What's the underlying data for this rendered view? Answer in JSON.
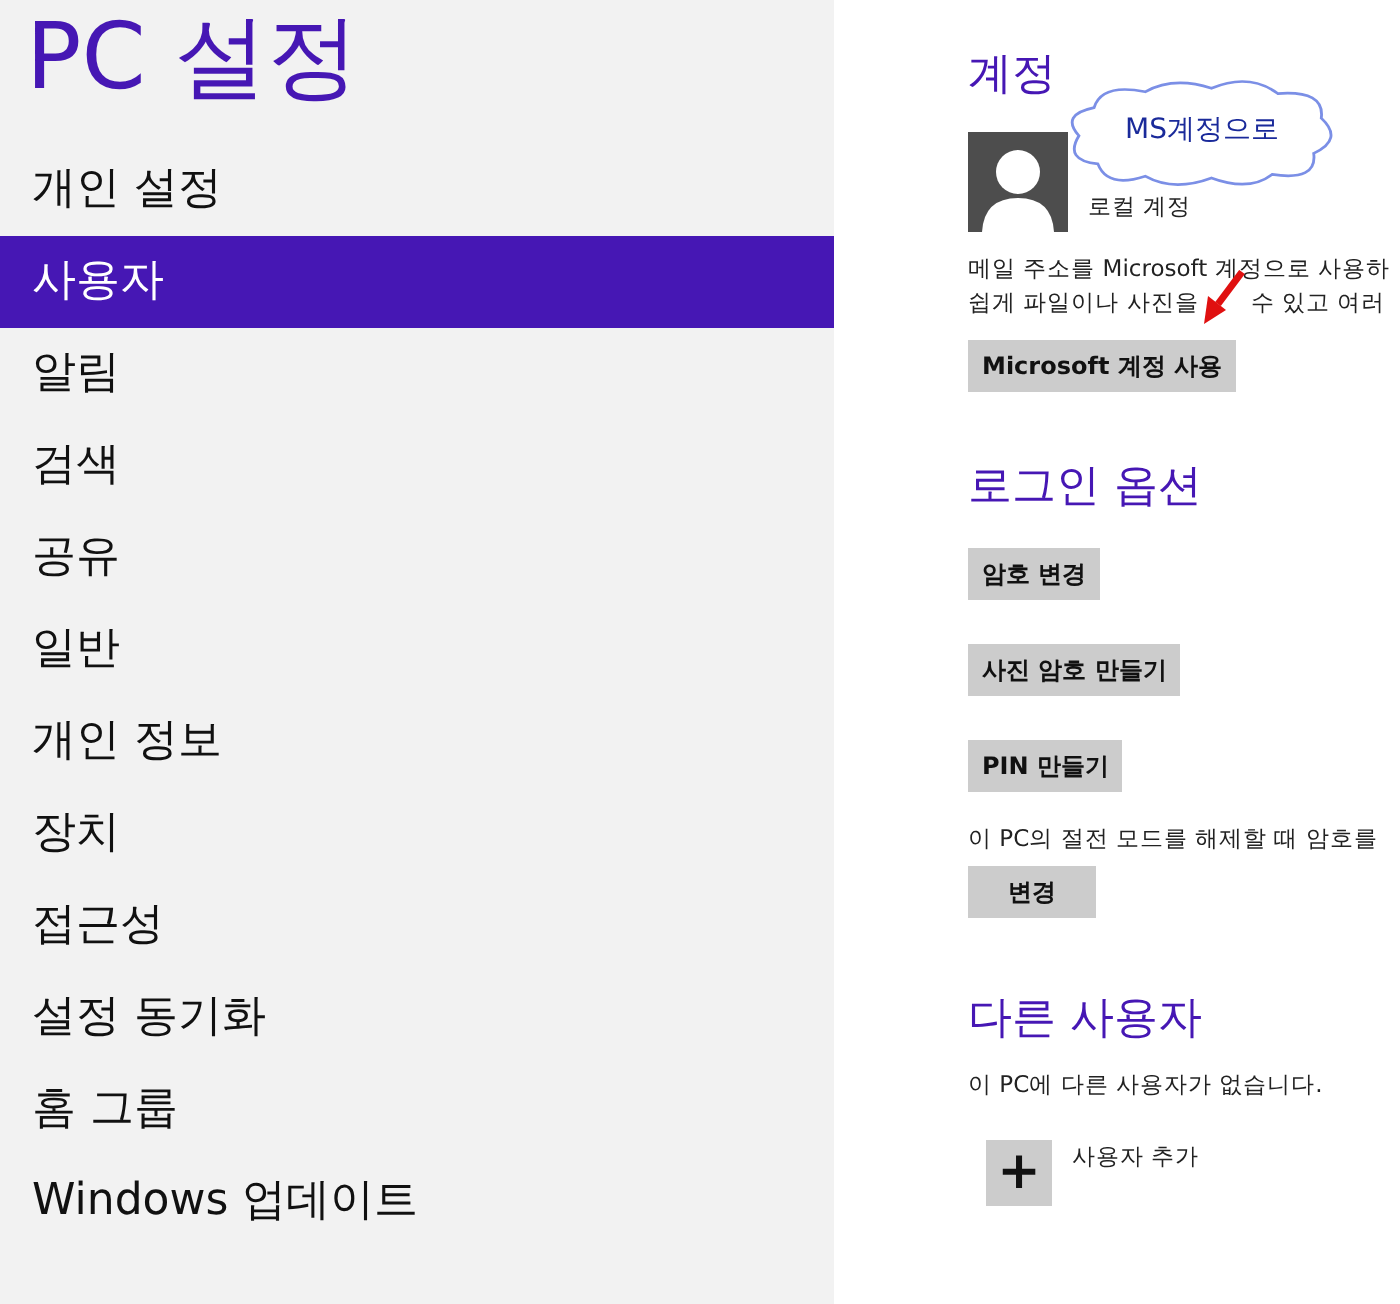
{
  "sidebar": {
    "title": "PC 설정",
    "items": [
      {
        "label": "개인 설정",
        "selected": false
      },
      {
        "label": "사용자",
        "selected": true
      },
      {
        "label": "알림",
        "selected": false
      },
      {
        "label": "검색",
        "selected": false
      },
      {
        "label": "공유",
        "selected": false
      },
      {
        "label": "일반",
        "selected": false
      },
      {
        "label": "개인 정보",
        "selected": false
      },
      {
        "label": "장치",
        "selected": false
      },
      {
        "label": "접근성",
        "selected": false
      },
      {
        "label": "설정 동기화",
        "selected": false
      },
      {
        "label": "홈 그룹",
        "selected": false
      },
      {
        "label": "Windows 업데이트",
        "selected": false
      }
    ]
  },
  "account": {
    "heading": "계정",
    "account_type": "로컬 계정",
    "description": [
      "메일 주소를 Microsoft 계정으로 사용하",
      "쉽게 파일이나 사진을",
      "수 있고 여러"
    ],
    "button": "Microsoft 계정 사용",
    "callout": "MS계정으로"
  },
  "sign_in_options": {
    "heading": "로그인 옵션",
    "buttons": [
      "암호 변경",
      "사진 암호 만들기",
      "PIN 만들기"
    ],
    "wake_text": "이 PC의 절전 모드를 해제할 때 암호를",
    "wake_button": "변경"
  },
  "other_users": {
    "heading": "다른 사용자",
    "text": "이 PC에 다른 사용자가 없습니다.",
    "add_icon": "+",
    "add_label": "사용자 추가"
  }
}
